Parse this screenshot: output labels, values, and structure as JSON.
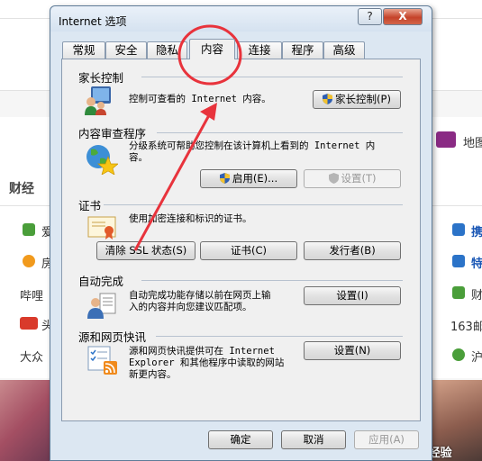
{
  "background": {
    "section_title": "财经",
    "right_link": "地图",
    "left_items": [
      "爱",
      "房",
      "哔哩",
      "头",
      "大众"
    ],
    "right_items": [
      "携",
      "特",
      "财",
      "163邮",
      "沪"
    ],
    "watermark": "Bai 经验",
    "colors": {
      "red_icon": "#d93a2b",
      "orange_icon": "#f19a1d",
      "green_icon": "#4a9e3a",
      "blue_icon": "#2b73c8",
      "purple_icon": "#8a2b84"
    }
  },
  "dialog": {
    "title": "Internet 选项",
    "help_label": "?",
    "close_label": "X",
    "tabs": [
      {
        "label": "常规",
        "active": false
      },
      {
        "label": "安全",
        "active": false
      },
      {
        "label": "隐私",
        "active": false
      },
      {
        "label": "内容",
        "active": true
      },
      {
        "label": "连接",
        "active": false
      },
      {
        "label": "程序",
        "active": false
      },
      {
        "label": "高级",
        "active": false
      }
    ],
    "parental": {
      "title": "家长控制",
      "desc": "控制可查看的 Internet 内容。",
      "button": "家长控制(P)"
    },
    "advisor": {
      "title": "内容审查程序",
      "desc_line1": "分级系统可帮助您控制在该计算机上看到的 Internet 内",
      "desc_line2": "容。",
      "enable_button": "启用(E)...",
      "settings_button": "设置(T)"
    },
    "certificates": {
      "title": "证书",
      "desc": "使用加密连接和标识的证书。",
      "clear_ssl_button": "清除 SSL 状态(S)",
      "certs_button": "证书(C)",
      "publishers_button": "发行者(B)"
    },
    "autocomplete": {
      "title": "自动完成",
      "desc_line1": "自动完成功能存储以前在网页上输",
      "desc_line2": "入的内容并向您建议匹配项。",
      "button": "设置(I)"
    },
    "feeds": {
      "title": "源和网页快讯",
      "desc_line1": "源和网页快讯提供可在 Internet",
      "desc_line2": "Explorer 和其他程序中读取的网站",
      "desc_line3": "新更内容。",
      "button": "设置(N)"
    },
    "footer": {
      "ok": "确定",
      "cancel": "取消",
      "apply": "应用(A)"
    }
  }
}
